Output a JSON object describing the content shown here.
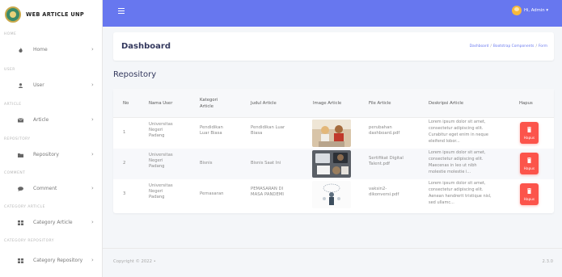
{
  "brand": {
    "name": "WEB ARTICLE UNP"
  },
  "sidebar": {
    "sections": [
      "HOME",
      "USER",
      "ARTICLE",
      "REPOSITORY",
      "COMMENT",
      "CATEGORY ARTICLE",
      "CATEGORY REPOSITORY"
    ],
    "items": [
      {
        "label": "Home",
        "icon": "fire-icon"
      },
      {
        "label": "User",
        "icon": "user-icon"
      },
      {
        "label": "Article",
        "icon": "envelope-icon"
      },
      {
        "label": "Repository",
        "icon": "folder-icon"
      },
      {
        "label": "Comment",
        "icon": "comment-icon"
      },
      {
        "label": "Category Article",
        "icon": "grid-icon"
      },
      {
        "label": "Category Repository",
        "icon": "grid-icon"
      }
    ]
  },
  "topbar": {
    "user_label": "Hi, Admin ▾"
  },
  "header": {
    "title": "Dashboard",
    "breadcrumb": [
      "Dashboard",
      "Bootstrap Components",
      "Form"
    ]
  },
  "repo_title": "Repository",
  "table": {
    "columns": [
      "No",
      "Nama User",
      "Kategori Article",
      "Judul Article",
      "Image Article",
      "File Article",
      "Deskripsi Article",
      "Hapus"
    ],
    "rows": [
      {
        "no": "1",
        "nama_user": [
          "Universitas",
          "Negeri",
          "Padang"
        ],
        "kategori": [
          "Pendidikan",
          "Luar Biasa"
        ],
        "judul": [
          "Pendidikan Luar",
          "Biasa"
        ],
        "file": [
          "perubahan",
          "dashboard.pdf"
        ],
        "deskripsi": [
          "Lorem ipsum dolor sit amet,",
          "consectetur adipiscing elit.",
          "Curabitur eget enim in neque",
          "eleifend lobor..."
        ]
      },
      {
        "no": "2",
        "nama_user": [
          "Universitas",
          "Negeri",
          "Padang"
        ],
        "kategori": [
          "Bisnis"
        ],
        "judul": [
          "Bisnis Saat Ini"
        ],
        "file": [
          "Sertifikat Digital",
          "Talent.pdf"
        ],
        "deskripsi": [
          "Lorem ipsum dolor sit amet,",
          "consectetur adipiscing elit.",
          "Maecenas in leo ut nibh",
          "molestie molestie i..."
        ]
      },
      {
        "no": "3",
        "nama_user": [
          "Universitas",
          "Negeri",
          "Padang"
        ],
        "kategori": [
          "Pemasaran"
        ],
        "judul": [
          "PEMASARAN DI",
          "MASA PANDEMI"
        ],
        "file": [
          "vaksin2-",
          "dikonversi.pdf"
        ],
        "deskripsi": [
          "Lorem ipsum dolor sit amet,",
          "consectetur adipiscing elit.",
          "Aenean hendrerit tristique nisl,",
          "sed ullamc..."
        ]
      }
    ],
    "delete_label": "Hapus"
  },
  "footer": {
    "copyright": "Copyright © 2022 •",
    "version": "2.3.0"
  },
  "colors": {
    "primary": "#6777ef",
    "danger": "#fc544b",
    "sidebar_bg": "#ffffff",
    "body_bg": "#f4f6f9"
  }
}
